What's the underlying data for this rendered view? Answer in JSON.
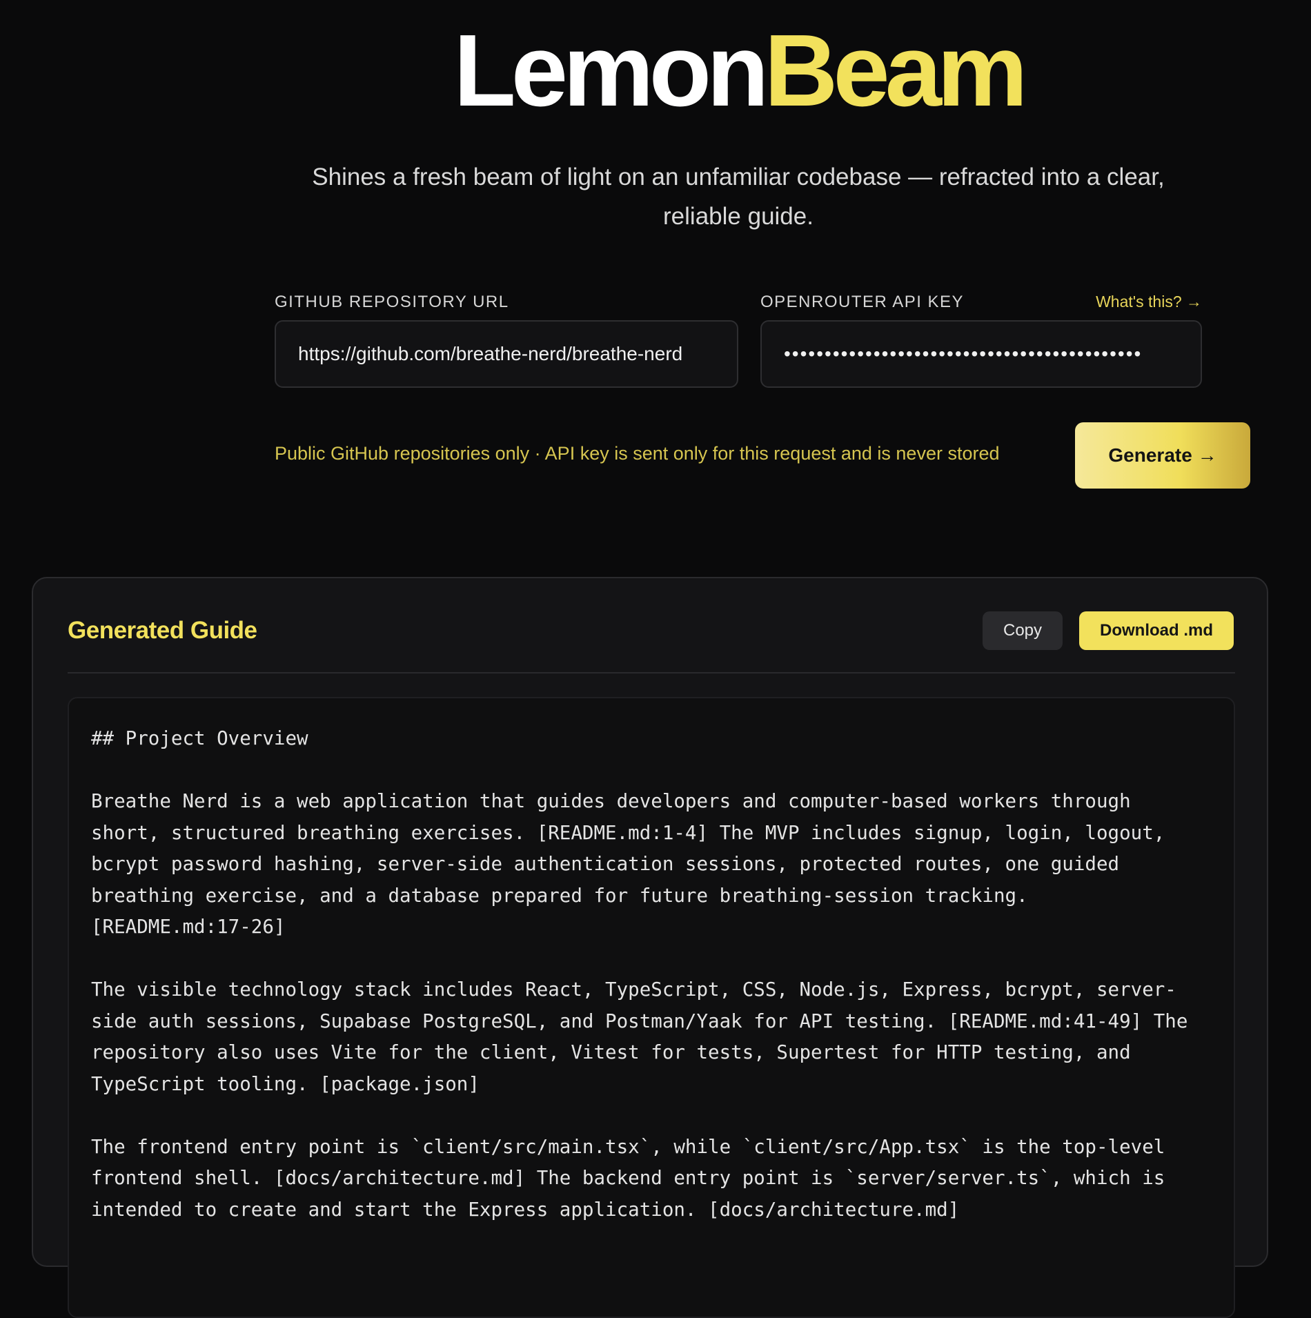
{
  "brand": {
    "part1": "Lemon",
    "part2": "Beam"
  },
  "tagline": "Shines a fresh beam of light on an unfamiliar codebase — refracted into a clear, reliable guide.",
  "form": {
    "repo_label": "GITHUB REPOSITORY URL",
    "repo_value": "https://github.com/breathe-nerd/breathe-nerd",
    "key_label": "OPENROUTER API KEY",
    "key_help": "What's this? →",
    "key_masked": "••••••••••••••••••••••••••••••••••••••••••••",
    "notice": "Public GitHub repositories only · API key is sent only for this request and is never stored",
    "generate_label": "Generate →"
  },
  "guide": {
    "title": "Generated Guide",
    "copy_label": "Copy",
    "download_label": "Download .md",
    "lines": [
      "## Project Overview",
      "",
      "Breathe Nerd is a web application that guides developers and computer-based workers through",
      "short, structured breathing exercises. [README.md:1-4] The MVP includes signup, login, logout,",
      "bcrypt password hashing, server-side authentication sessions, protected routes, one guided",
      "breathing exercise, and a database prepared for future breathing-session tracking.",
      "[README.md:17-26]",
      "",
      "The visible technology stack includes React, TypeScript, CSS, Node.js, Express, bcrypt, server-",
      "side auth sessions, Supabase PostgreSQL, and Postman/Yaak for API testing. [README.md:41-49] The",
      "repository also uses Vite for the client, Vitest for tests, Supertest for HTTP testing, and",
      "TypeScript tooling. [package.json]",
      "",
      "The frontend entry point is `client/src/main.tsx`, while `client/src/App.tsx` is the top-level",
      "frontend shell. [docs/architecture.md] The backend entry point is `server/server.ts`, which is",
      "intended to create and start the Express application. [docs/architecture.md]"
    ]
  }
}
